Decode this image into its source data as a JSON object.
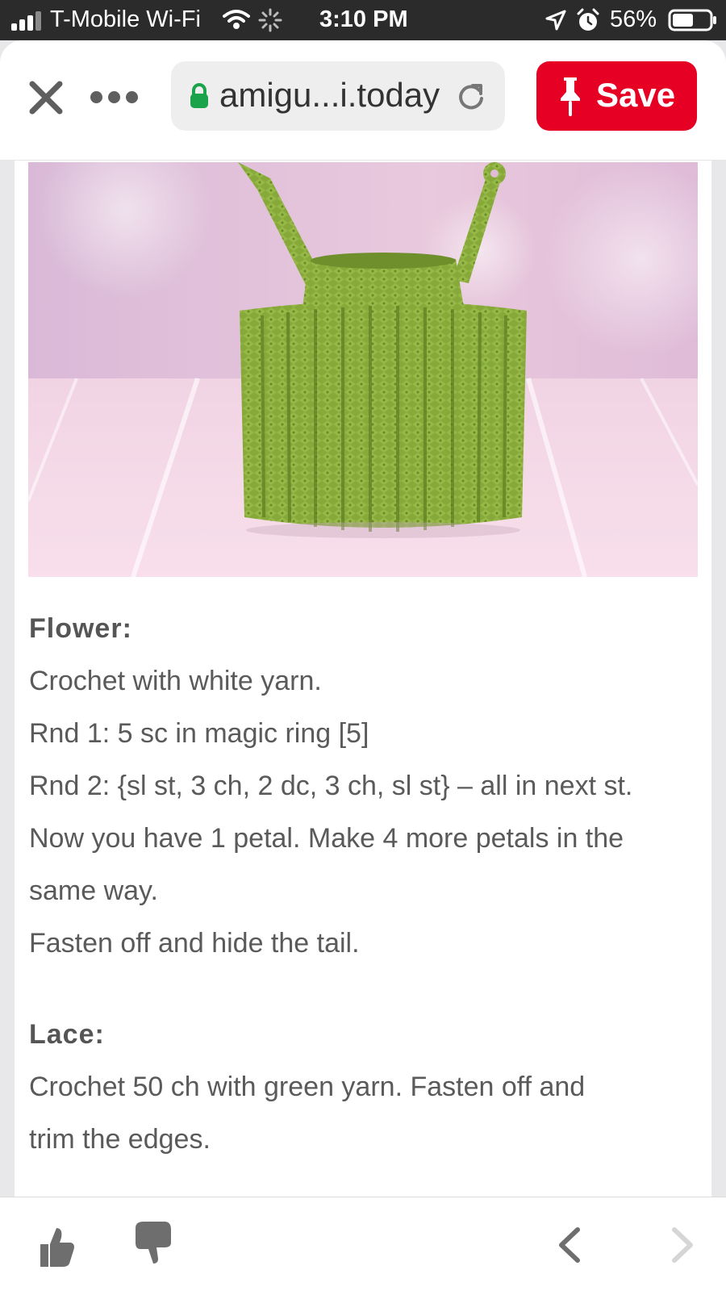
{
  "status_bar": {
    "carrier": "T-Mobile Wi-Fi",
    "time": "3:10 PM",
    "battery": "56%",
    "battery_level": 0.56,
    "icons": [
      "signal-icon",
      "wifi-icon",
      "spinner-icon",
      "location-icon",
      "alarm-icon",
      "battery-icon"
    ]
  },
  "browser": {
    "url": "amigu...i.today",
    "save_label": "Save",
    "icons": [
      "close-icon",
      "more-icon",
      "lock-icon",
      "reload-icon",
      "pin-icon"
    ]
  },
  "article": {
    "flower_heading": "Flower:",
    "flower_lines": [
      "Crochet with white yarn.",
      "Rnd 1: 5 sc in magic ring [5]",
      "Rnd 2: {sl st, 3 ch, 2 dc, 3 ch, sl st} – all in next st.",
      "Now you have 1 petal. Make 4 more petals in the",
      "same way.",
      "Fasten off and hide the tail."
    ],
    "lace_heading": "Lace:",
    "lace_lines": [
      "Crochet 50 ch with green yarn. Fasten off and",
      "trim the edges."
    ]
  },
  "bottom_bar": {
    "icons": [
      "thumbs-up-icon",
      "thumbs-down-icon",
      "back-icon",
      "forward-icon"
    ]
  },
  "colors": {
    "brand_red": "#e60023",
    "status_bar_bg": "#2b2b2b",
    "text": "#5a5a5a",
    "yarn_green": "#86a93a",
    "photo_pink": "#e9c7dc"
  }
}
